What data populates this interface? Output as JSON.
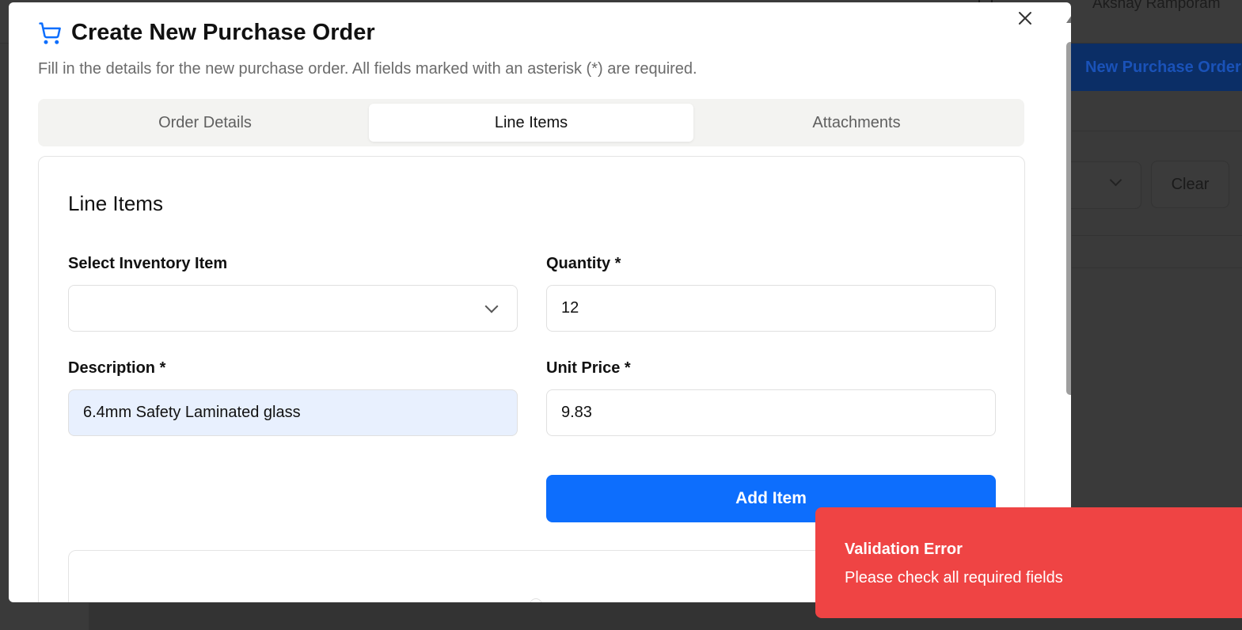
{
  "background": {
    "app_title_fragment": "...",
    "user_name": "Akshay Ramporam",
    "new_po_button": "New Purchase Order",
    "clear_button": "Clear"
  },
  "modal": {
    "title": "Create New Purchase Order",
    "subtitle": "Fill in the details for the new purchase order. All fields marked with an asterisk (*) are required.",
    "tabs": [
      {
        "label": "Order Details",
        "active": false
      },
      {
        "label": "Line Items",
        "active": true
      },
      {
        "label": "Attachments",
        "active": false
      }
    ],
    "section_title": "Line Items",
    "fields": {
      "inventory_item": {
        "label": "Select Inventory Item",
        "value": ""
      },
      "quantity": {
        "label": "Quantity *",
        "value": "12"
      },
      "description": {
        "label": "Description *",
        "value": "6.4mm Safety Laminated glass"
      },
      "unit_price": {
        "label": "Unit Price *",
        "value": "9.83"
      }
    },
    "add_item_button": "Add Item"
  },
  "toast": {
    "title": "Validation Error",
    "description": "Please check all required fields"
  },
  "colors": {
    "primary": "#0d6efd",
    "error": "#ef4444",
    "autofill": "#e8f0fe"
  }
}
